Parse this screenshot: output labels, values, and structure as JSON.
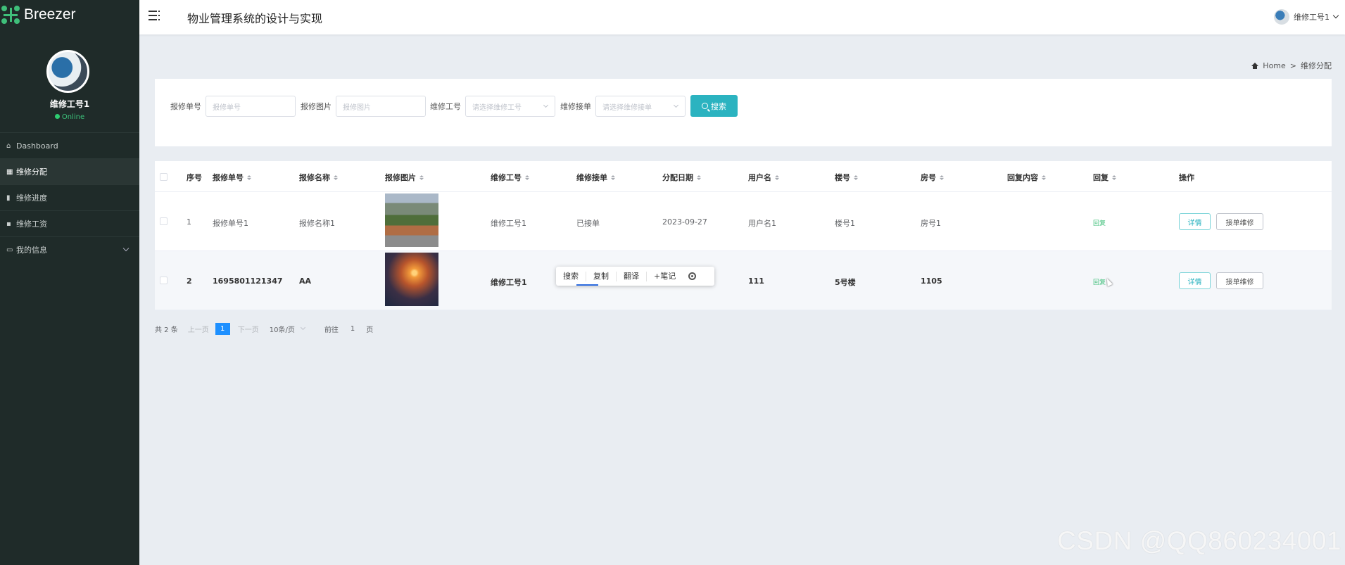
{
  "brand": {
    "name": "Breezer"
  },
  "profile": {
    "name": "维修工号1",
    "status": "Online"
  },
  "sidebar": {
    "items": [
      {
        "label": "Dashboard",
        "icon": "home-icon"
      },
      {
        "label": "维修分配",
        "icon": "grid-icon",
        "active": true
      },
      {
        "label": "维修进度",
        "icon": "bar-chart-icon"
      },
      {
        "label": "维修工资",
        "icon": "wallet-icon"
      },
      {
        "label": "我的信息",
        "icon": "card-icon",
        "expandable": true
      }
    ]
  },
  "header": {
    "title": "物业管理系统的设计与实现",
    "user": "维修工号1"
  },
  "breadcrumb": {
    "home": "Home",
    "separator": ">",
    "current": "维修分配"
  },
  "search": {
    "fields": [
      {
        "label": "报修单号",
        "placeholder": "报修单号"
      },
      {
        "label": "报修图片",
        "placeholder": "报修图片"
      },
      {
        "label": "维修工号",
        "placeholder": "请选择维修工号"
      },
      {
        "label": "维修接单",
        "placeholder": "请选择维修接单"
      }
    ],
    "button": "搜索"
  },
  "table": {
    "columns": [
      "序号",
      "报修单号",
      "报修名称",
      "报修图片",
      "维修工号",
      "维修接单",
      "分配日期",
      "用户名",
      "楼号",
      "房号",
      "回复内容",
      "回复",
      "操作"
    ],
    "rows": [
      {
        "index": "1",
        "order_no": "报修单号1",
        "name": "报修名称1",
        "worker": "维修工号1",
        "accepted": "已接单",
        "date": "2023-09-27",
        "user": "用户名1",
        "building": "楼号1",
        "room": "房号1",
        "reply_content": "",
        "reply": "回复"
      },
      {
        "index": "2",
        "order_no": "1695801121347",
        "name": "AA",
        "worker": "维修工号1",
        "accepted": "",
        "date": "",
        "user": "111",
        "building": "5号楼",
        "room": "1105",
        "reply_content": "",
        "reply": "回复"
      }
    ],
    "actions": {
      "detail": "详情",
      "take": "接单维修"
    }
  },
  "context_menu": {
    "items": [
      "搜索",
      "复制",
      "翻译",
      "+笔记"
    ]
  },
  "pagination": {
    "total": "共 2 条",
    "prev": "上一页",
    "current": "1",
    "next": "下一页",
    "page_size": "10条/页",
    "goto_prefix": "前往",
    "goto_page": "1",
    "goto_suffix": "页"
  },
  "watermark": "CSDN @QQ860234001",
  "colors": {
    "sidebar_bg": "#1f2b29",
    "accent": "#2bb3c0",
    "reply_green": "#3fbf7a",
    "page_active": "#1e90ff"
  }
}
